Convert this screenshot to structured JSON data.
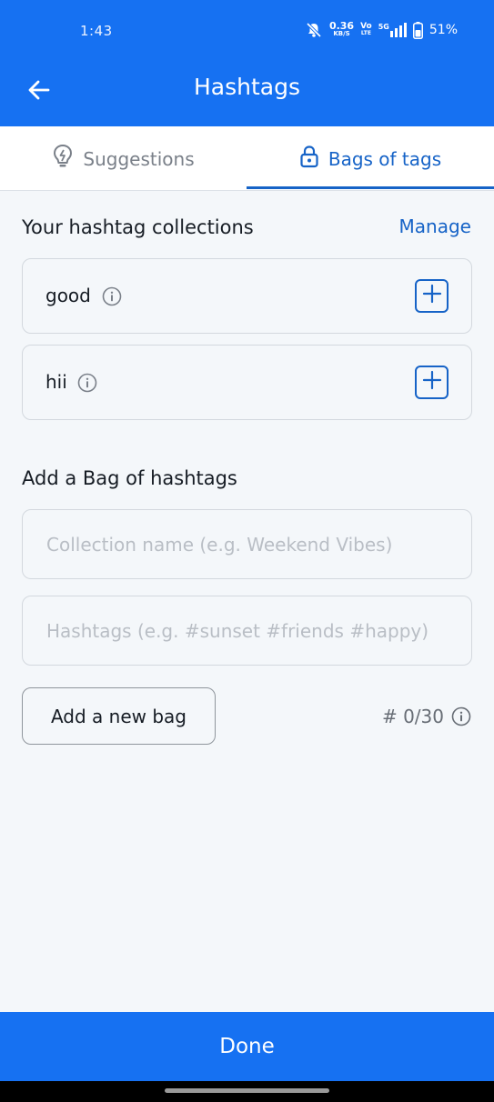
{
  "status_bar": {
    "time": "1:43",
    "net_speed_value": "0.36",
    "net_speed_unit": "KB/S",
    "volte_top": "Vo",
    "volte_bottom": "LTE",
    "network": "5G",
    "battery_percent": "51%"
  },
  "app_bar": {
    "title": "Hashtags",
    "back_icon": "arrow-left-icon"
  },
  "tabs": [
    {
      "label": "Suggestions",
      "icon": "lightbulb-icon",
      "active": false
    },
    {
      "label": "Bags of tags",
      "icon": "lock-icon",
      "active": true
    }
  ],
  "collections": {
    "title": "Your hashtag collections",
    "manage_label": "Manage",
    "items": [
      {
        "name": "good"
      },
      {
        "name": "hii"
      }
    ]
  },
  "add_bag": {
    "title": "Add a Bag of hashtags",
    "name_field": {
      "value": "",
      "placeholder": "Collection name (e.g. Weekend Vibes)"
    },
    "hashtags_field": {
      "value": "",
      "placeholder": "Hashtags (e.g. #sunset #friends #happy)"
    },
    "button_label": "Add a new bag",
    "counter": "# 0/30"
  },
  "footer": {
    "done_label": "Done"
  },
  "colors": {
    "primary": "#1671f2",
    "accent": "#1663c7",
    "background": "#f4f7fa"
  }
}
